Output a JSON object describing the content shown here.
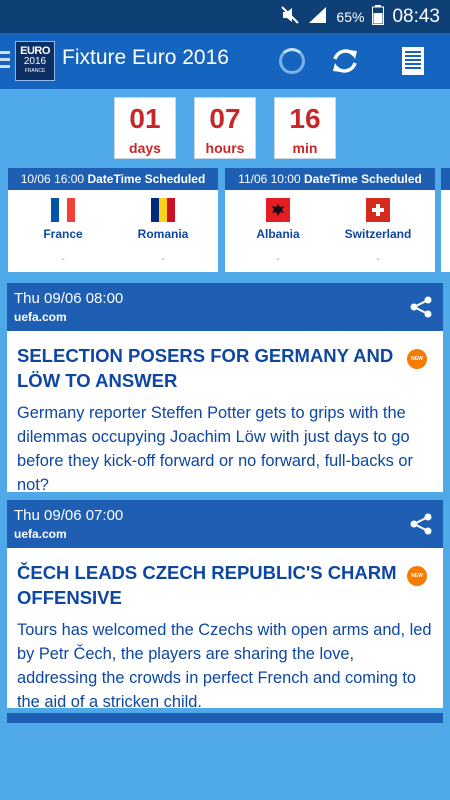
{
  "status_bar": {
    "battery_percent": "65%",
    "time": "08:43"
  },
  "app_bar": {
    "logo": {
      "line1": "EURO",
      "line2": "2016",
      "line3": "FRANCE"
    },
    "title": "Fixture Euro 2016",
    "icons": [
      "menu-icon",
      "spinner-icon",
      "refresh-icon",
      "list-icon"
    ]
  },
  "countdown": [
    {
      "value": "01",
      "unit": "days"
    },
    {
      "value": "07",
      "unit": "hours"
    },
    {
      "value": "16",
      "unit": "min"
    }
  ],
  "matches": [
    {
      "datetime": "10/06 16:00",
      "status": "DateTime Scheduled",
      "home": {
        "name": "France",
        "score": "-"
      },
      "away": {
        "name": "Romania",
        "score": "-"
      }
    },
    {
      "datetime": "11/06 10:00",
      "status": "DateTime Scheduled",
      "home": {
        "name": "Albania",
        "score": "-"
      },
      "away": {
        "name": "Switzerland",
        "score": "-"
      }
    }
  ],
  "news": [
    {
      "date": "Thu 09/06 08:00",
      "source": "uefa.com",
      "badge": "NEW",
      "title": "SELECTION POSERS FOR GERMANY AND LÖW TO ANSWER",
      "desc": "Germany reporter Steffen Potter gets to grips with the dilemmas occupying Joachim Löw with just days to go before they kick-off  forward or no forward, full-backs or not?"
    },
    {
      "date": "Thu 09/06 07:00",
      "source": "uefa.com",
      "badge": "NEW",
      "title": "ČECH LEADS CZECH REPUBLIC'S CHARM OFFENSIVE",
      "desc": "Tours has welcomed the Czechs with open arms and, led by Petr Čech, the players are sharing the love, addressing the crowds in perfect French and coming to the aid of a stricken child."
    }
  ],
  "colors": {
    "background": "#4fa8e8",
    "app_bar": "#1565c0",
    "card_header": "#1e5fb4",
    "accent_red": "#c62828",
    "text_blue": "#0d47a1",
    "badge_orange": "#f57c00"
  }
}
